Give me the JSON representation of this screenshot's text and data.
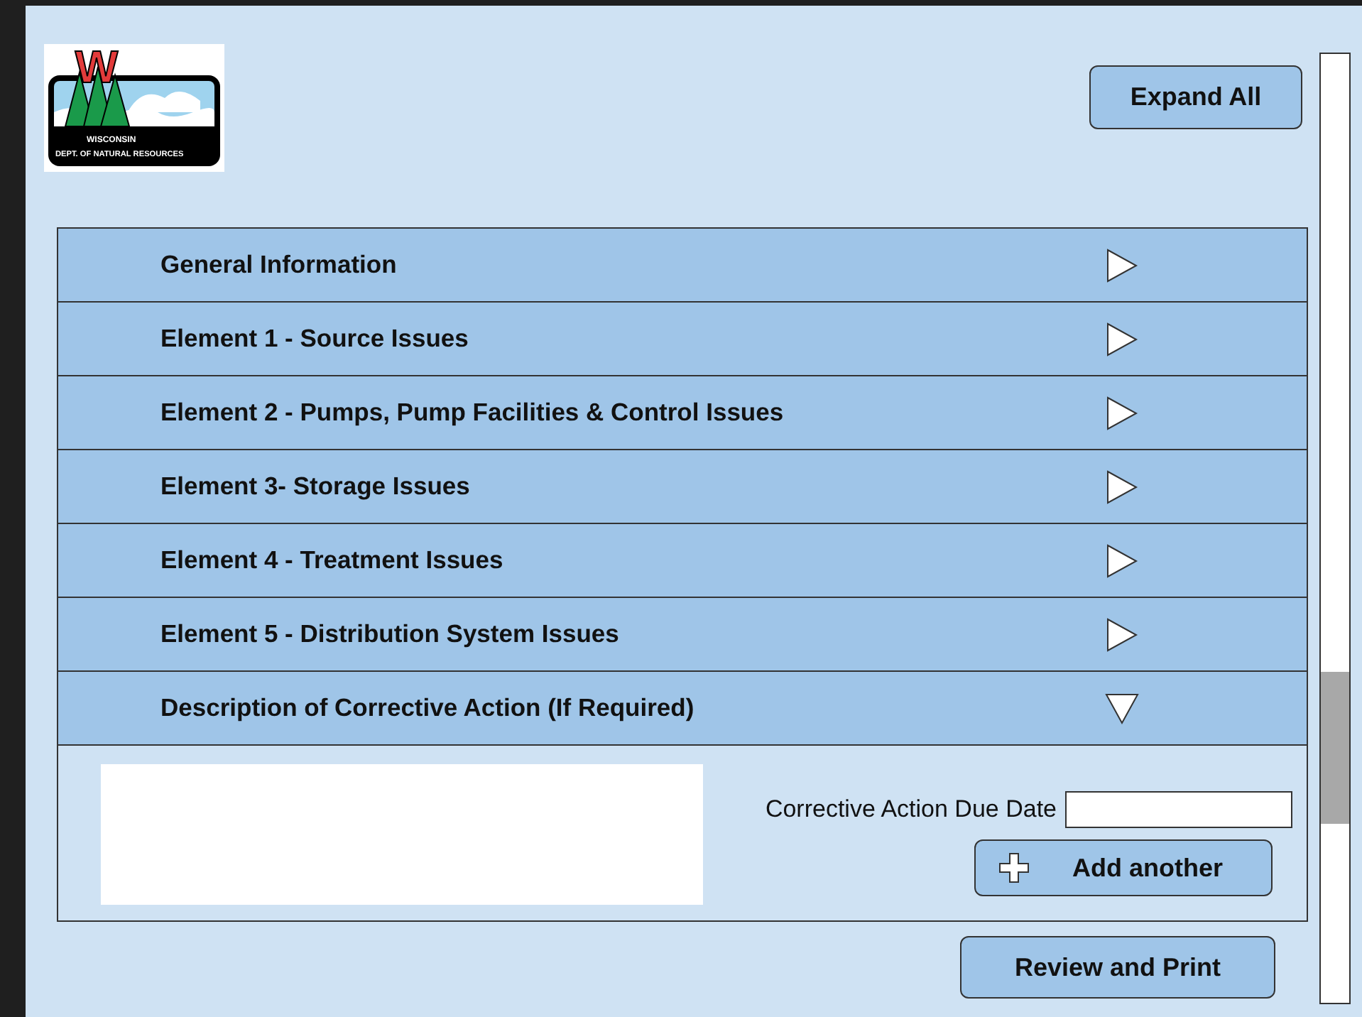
{
  "logo": {
    "letter": "W",
    "line_1": "WISCONSIN",
    "line_2": "DEPT. OF NATURAL RESOURCES"
  },
  "expand_all": "Expand All",
  "sections": [
    {
      "label": "General Information",
      "expanded": false
    },
    {
      "label": "Element 1 - Source Issues",
      "expanded": false
    },
    {
      "label": "Element 2 - Pumps, Pump Facilities & Control Issues",
      "expanded": false
    },
    {
      "label": "Element 3- Storage Issues",
      "expanded": false
    },
    {
      "label": "Element 4 - Treatment Issues",
      "expanded": false
    },
    {
      "label": "Element 5  - Distribution System Issues",
      "expanded": false
    },
    {
      "label": "Description of Corrective Action (If Required)",
      "expanded": true
    }
  ],
  "corrective_action": {
    "due_date_label": "Corrective Action Due Date",
    "add_button": "Add another"
  },
  "review_button": "Review and Print"
}
